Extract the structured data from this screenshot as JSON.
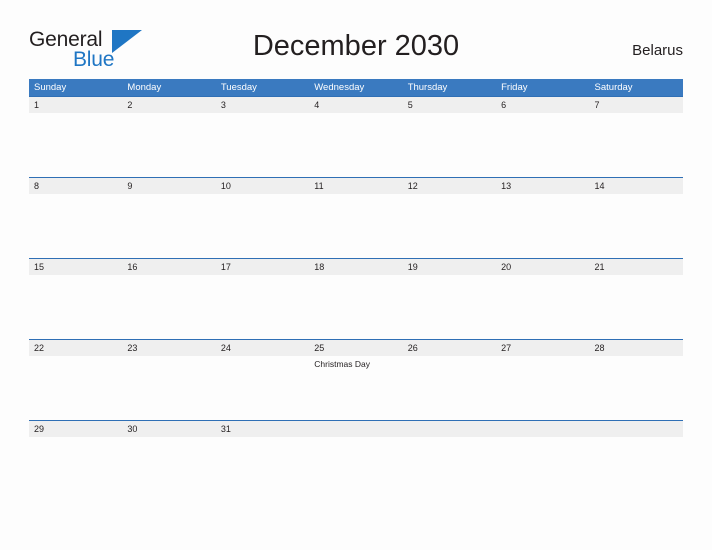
{
  "brand": {
    "name_part1": "General",
    "name_part2": "Blue",
    "flag_icon": "blue-flag-triangle",
    "color_dark": "#231f20",
    "color_blue": "#1f76c4"
  },
  "header": {
    "title": "December 2030",
    "country": "Belarus"
  },
  "theme": {
    "header_blue": "#3a7ac0",
    "row_border_blue": "#2f6fb5",
    "date_band_gray": "#efefef",
    "page_background": "#fdfdfd",
    "text_dark": "#231f20",
    "weekday_text": "#ffffff"
  },
  "calendar": {
    "weekdays": [
      "Sunday",
      "Monday",
      "Tuesday",
      "Wednesday",
      "Thursday",
      "Friday",
      "Saturday"
    ],
    "weeks": [
      {
        "days": [
          {
            "number": "1",
            "events": []
          },
          {
            "number": "2",
            "events": []
          },
          {
            "number": "3",
            "events": []
          },
          {
            "number": "4",
            "events": []
          },
          {
            "number": "5",
            "events": []
          },
          {
            "number": "6",
            "events": []
          },
          {
            "number": "7",
            "events": []
          }
        ]
      },
      {
        "days": [
          {
            "number": "8",
            "events": []
          },
          {
            "number": "9",
            "events": []
          },
          {
            "number": "10",
            "events": []
          },
          {
            "number": "11",
            "events": []
          },
          {
            "number": "12",
            "events": []
          },
          {
            "number": "13",
            "events": []
          },
          {
            "number": "14",
            "events": []
          }
        ]
      },
      {
        "days": [
          {
            "number": "15",
            "events": []
          },
          {
            "number": "16",
            "events": []
          },
          {
            "number": "17",
            "events": []
          },
          {
            "number": "18",
            "events": []
          },
          {
            "number": "19",
            "events": []
          },
          {
            "number": "20",
            "events": []
          },
          {
            "number": "21",
            "events": []
          }
        ]
      },
      {
        "days": [
          {
            "number": "22",
            "events": []
          },
          {
            "number": "23",
            "events": []
          },
          {
            "number": "24",
            "events": []
          },
          {
            "number": "25",
            "events": [
              "Christmas Day"
            ]
          },
          {
            "number": "26",
            "events": []
          },
          {
            "number": "27",
            "events": []
          },
          {
            "number": "28",
            "events": []
          }
        ]
      },
      {
        "days": [
          {
            "number": "29",
            "events": []
          },
          {
            "number": "30",
            "events": []
          },
          {
            "number": "31",
            "events": []
          },
          {
            "number": "",
            "events": []
          },
          {
            "number": "",
            "events": []
          },
          {
            "number": "",
            "events": []
          },
          {
            "number": "",
            "events": []
          }
        ]
      }
    ]
  }
}
